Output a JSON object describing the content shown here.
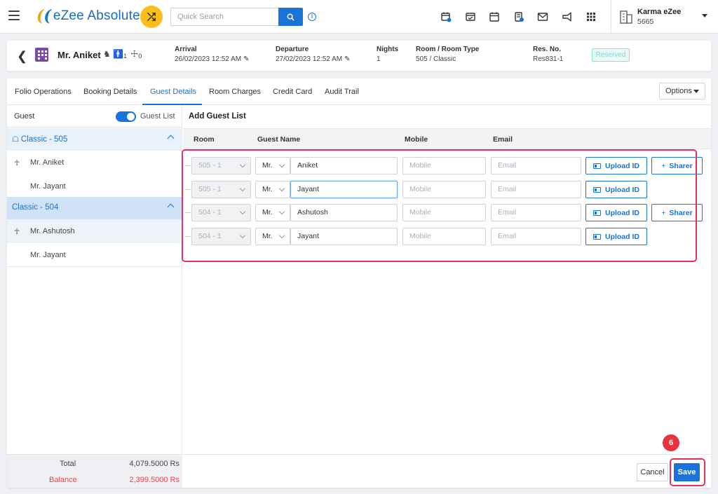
{
  "app": {
    "logo_text": "eZee Absolute",
    "search_placeholder": "Quick Search",
    "user_name": "Karma eZee",
    "user_code": "5665"
  },
  "reservation": {
    "guest_name": "Mr. Aniket",
    "adults": "1",
    "children": "0",
    "arrival_label": "Arrival",
    "arrival_value": "26/02/2023 12:52 AM",
    "departure_label": "Departure",
    "departure_value": "27/02/2023 12:52 AM",
    "nights_label": "Nights",
    "nights_value": "1",
    "room_label": "Room / Room Type",
    "room_value": "505 / Classic",
    "resno_label": "Res. No.",
    "resno_value": "Res831-1",
    "status": "Reserved"
  },
  "tabs": [
    "Folio Operations",
    "Booking Details",
    "Guest Details",
    "Room Charges",
    "Credit Card",
    "Audit Trail"
  ],
  "active_tab": "Guest Details",
  "options_label": "Options",
  "left_panel": {
    "title": "Guest",
    "toggle_label": "Guest List",
    "groups": [
      {
        "label": "Classic - 505",
        "guests": [
          "Mr. Aniket",
          "Mr. Jayant"
        ]
      },
      {
        "label": "Classic - 504",
        "guests": [
          "Mr. Ashutosh",
          "Mr. Jayant"
        ]
      }
    ],
    "total_label": "Total",
    "total_value": "4,079.5000 Rs",
    "balance_label": "Balance",
    "balance_value": "2,399.5000 Rs"
  },
  "guest_list": {
    "title": "Add Guest List",
    "columns": {
      "room": "Room",
      "guest_name": "Guest Name",
      "mobile": "Mobile",
      "email": "Email"
    },
    "mobile_placeholder": "Mobile",
    "email_placeholder": "Email",
    "upload_label": "Upload ID",
    "sharer_label": "Sharer",
    "rows": [
      {
        "room": "505 - 1",
        "salutation": "Mr.",
        "name": "Aniket",
        "sharer": true
      },
      {
        "room": "505 - 1",
        "salutation": "Mr.",
        "name": "Jayant",
        "sharer": false
      },
      {
        "room": "504 - 1",
        "salutation": "Mr.",
        "name": "Ashutosh",
        "sharer": true
      },
      {
        "room": "504 - 1",
        "salutation": "Mr.",
        "name": "Jayant",
        "sharer": false
      }
    ]
  },
  "actions": {
    "cancel": "Cancel",
    "save": "Save",
    "step": "6"
  },
  "colors": {
    "accent": "#1a73d9",
    "highlight": "#e6315a",
    "logo_yellow": "#f8be1e",
    "hotel_icon": "#7b4aa8"
  }
}
